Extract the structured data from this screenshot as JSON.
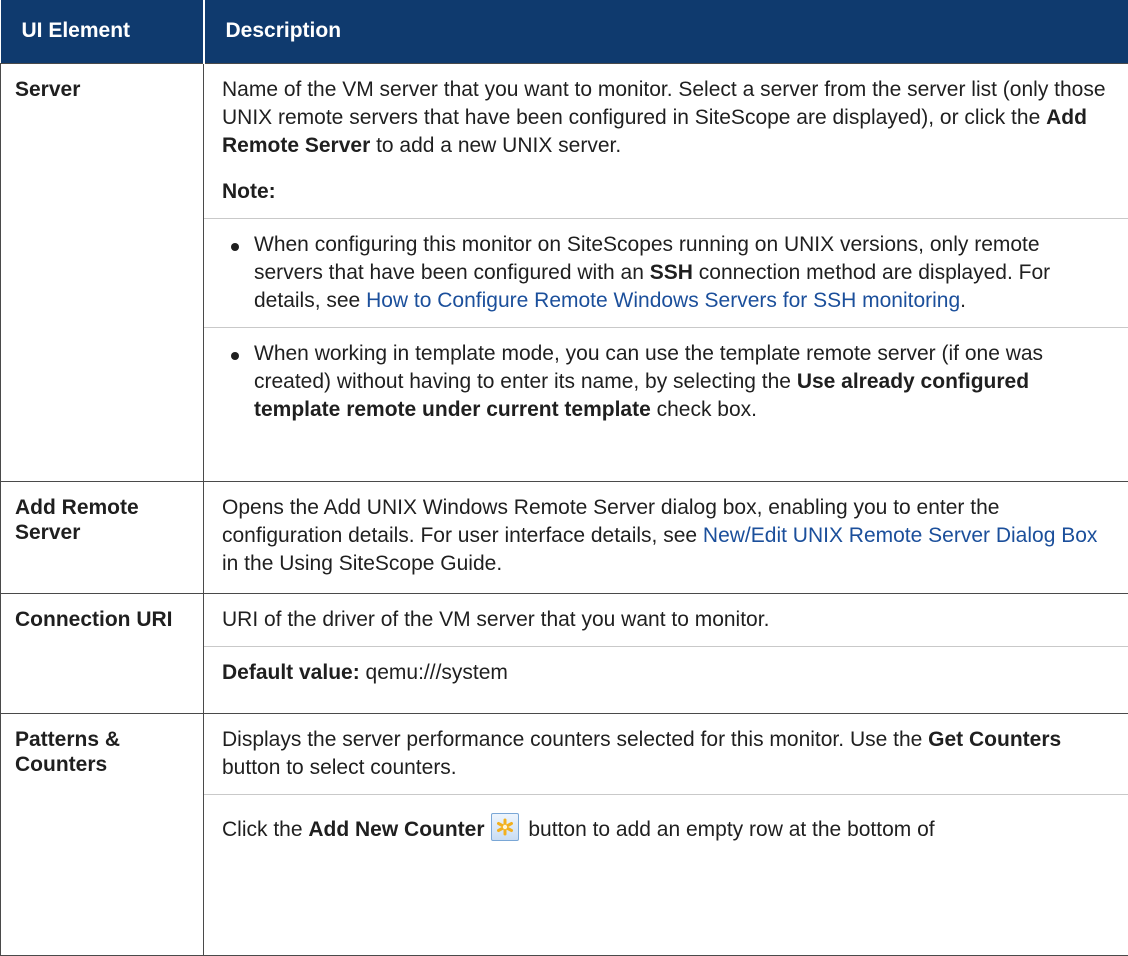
{
  "header": {
    "col1": "UI Element",
    "col2": "Description"
  },
  "rows": {
    "server": {
      "name": "Server",
      "desc_p1a": "Name of the VM server that you want to monitor. Select a server from the server list (only those UNIX remote servers that have been configured in SiteScope are displayed), or click the ",
      "desc_p1b": "Add Remote Server",
      "desc_p1c": " to add a new UNIX server.",
      "note_label": "Note:",
      "bullet1a": "When configuring this monitor on SiteScopes running on UNIX versions, only remote servers that have been configured with an ",
      "bullet1b": "SSH",
      "bullet1c": " connection method are displayed. For details, see ",
      "bullet1_link": "How to Configure Remote Windows Servers for SSH monitoring",
      "bullet1d": ".",
      "bullet2a": "When working in template mode, you can use the template remote server (if one was created) without having to enter its name, by selecting the ",
      "bullet2b": "Use already configured template remote under current template",
      "bullet2c": " check box."
    },
    "add_remote": {
      "name": "Add Remote Server",
      "desc_a": "Opens the Add UNIX Windows Remote Server dialog box, enabling you to enter the configuration details. For user interface details, see ",
      "desc_link": "New/Edit UNIX Remote Server Dialog Box",
      "desc_b": " in the Using SiteScope Guide."
    },
    "connection_uri": {
      "name": "Connection URI",
      "desc": "URI of the driver of the VM server that you want to monitor.",
      "default_label": "Default value:",
      "default_value": " qemu:///system"
    },
    "patterns": {
      "name": "Patterns & Counters",
      "desc_a": "Displays the server performance counters selected for this monitor. Use the ",
      "desc_b": "Get Counters",
      "desc_c": " button to select counters.",
      "click_a": "Click the ",
      "click_b": "Add New Counter",
      "click_c": " button to add an empty row at the bottom of"
    }
  },
  "icons": {
    "add_new_counter": "asterisk-icon"
  },
  "colors": {
    "header_bg": "#0f3a6e",
    "link": "#1b4f9b"
  }
}
